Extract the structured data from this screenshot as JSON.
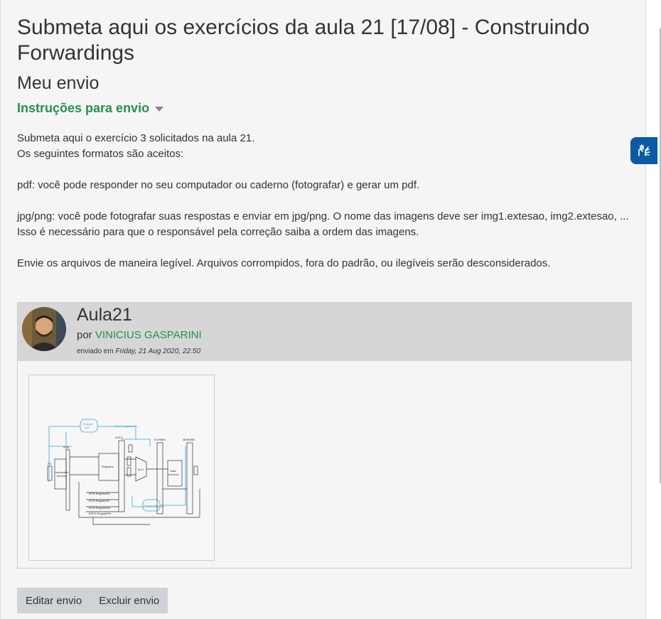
{
  "page": {
    "title": "Submeta aqui os exercícios da aula 21 [17/08] - Construindo Forwardings",
    "subtitle": "Meu envio",
    "instructions_toggle": "Instruções para envio"
  },
  "instructions": {
    "lines": [
      "Submeta aqui o exercício 3 solicitados na aula 21.",
      "Os seguintes formatos são aceitos:",
      "pdf: você pode responder no seu computador ou caderno (fotografar) e gerar um pdf.",
      "jpg/png: você pode fotografar suas respostas e enviar em jpg/png. O nome das imagens deve ser img1.extesao, img2.extesao, ...",
      "Isso é necessário para que o responsável pela correção saiba a ordem das imagens.",
      "Envie os arquivos de maneira legível. Arquivos corrompidos, fora do padrão, ou ilegíveis serão desconsiderados."
    ]
  },
  "submission": {
    "title": "Aula21",
    "by_prefix": "por",
    "author": "VINICIUS GASPARINI",
    "sent_prefix": "enviado em",
    "sent_date": "Friday, 21 Aug 2020, 22:50",
    "diagram": {
      "labels": {
        "forward_unit": "Forward\nunit",
        "id_ex": "ID/EX",
        "ex_mem": "EX/MEM",
        "mem_wb": "MEM/WB",
        "if_id": "IF/ID",
        "pc": "PC",
        "instruction_memory": "Instruction\nmemory",
        "registers": "Registers",
        "data_memory": "Data\nmemory",
        "alu": "ALU",
        "forwarding_unit": "Forwarding\nunit",
        "idex_regwrite": "ID/EX.RegisterRd",
        "if_id_rs": "IF/ID.RegisterRs",
        "if_id_rt": "IF/ID.RegisterRt",
        "if_id_rd": "IF/ID.RegisterRd",
        "idex_rs": "ID/EX.RegisterRs",
        "mux": "M"
      }
    }
  },
  "actions": {
    "edit": "Editar envio",
    "delete": "Excluir envio"
  },
  "colors": {
    "accent_green": "#23924b",
    "header_gray": "#d6d6d6",
    "accessibility_blue": "#0a5aa6"
  },
  "icons": {
    "accessibility": "hands-sign-language-icon",
    "caret": "caret-down-icon"
  }
}
